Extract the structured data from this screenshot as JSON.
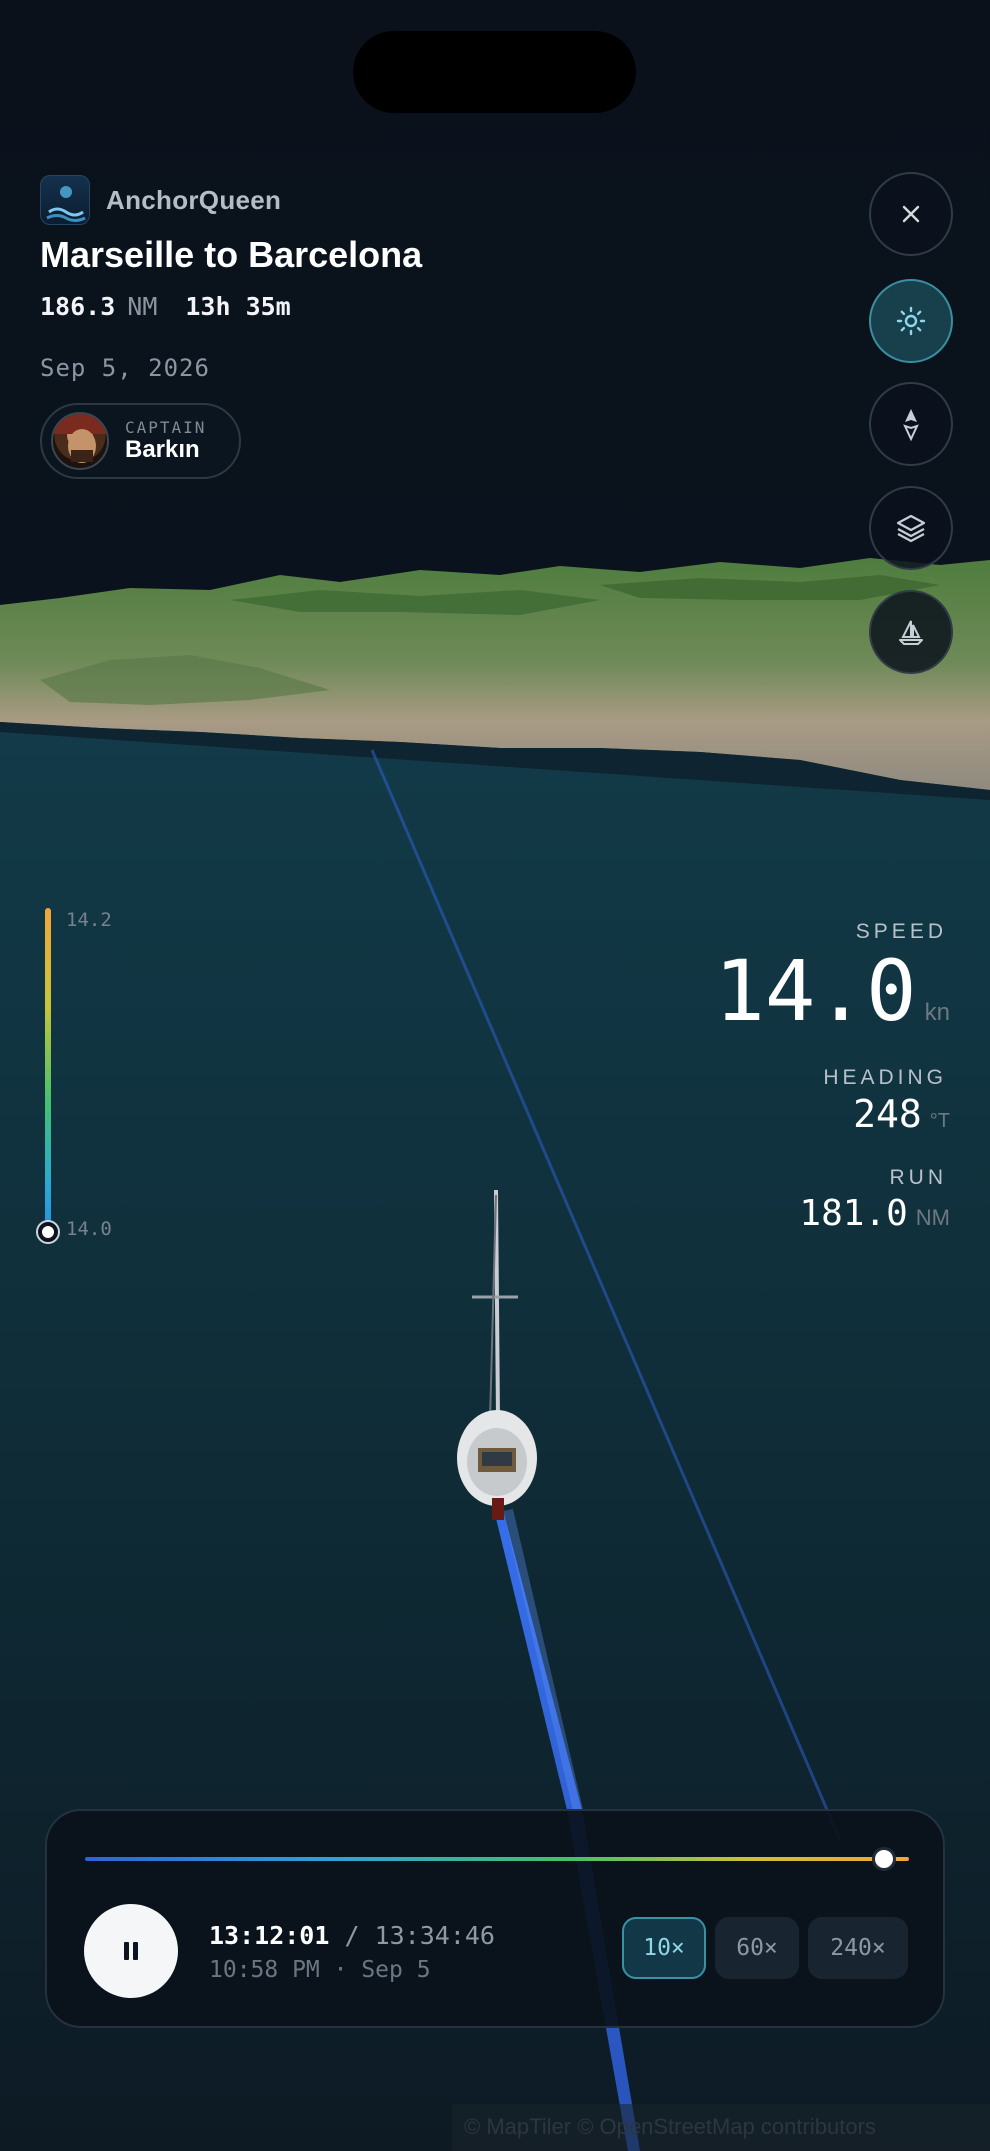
{
  "app": {
    "name": "AnchorQueen"
  },
  "trip": {
    "title": "Marseille to Barcelona",
    "distance_value": "186.3",
    "distance_unit": "NM",
    "duration": "13h 35m",
    "date": "Sep 5, 2026"
  },
  "captain": {
    "role_label": "CAPTAIN",
    "name": "Barkın"
  },
  "legend": {
    "max_label": "14.2",
    "min_label": "14.0"
  },
  "metrics": {
    "speed": {
      "label": "SPEED",
      "value": "14.0",
      "unit": "kn"
    },
    "heading": {
      "label": "HEADING",
      "value": "248",
      "unit": "°T"
    },
    "run": {
      "label": "RUN",
      "value": "181.0",
      "unit": "NM"
    }
  },
  "playback": {
    "elapsed": "13:12:01",
    "separator": " / ",
    "total": "13:34:46",
    "clock_sub": "10:58 PM · Sep 5",
    "progress": 0.97,
    "speeds": [
      {
        "label": "10×",
        "active": true
      },
      {
        "label": "60×",
        "active": false
      },
      {
        "label": "240×",
        "active": false
      }
    ]
  },
  "toolbar": {
    "close_icon": "close-icon",
    "light_icon": "sun-icon",
    "compass_icon": "compass-icon",
    "layers_icon": "layers-icon",
    "boat_icon": "sailboat-icon"
  },
  "attribution": "© MapTiler © OpenStreetMap contributors",
  "colors": {
    "accent": "#3a91a6",
    "track": "#2f63d8",
    "sea": "#0f2f3a",
    "land": "#4d7a3c"
  }
}
